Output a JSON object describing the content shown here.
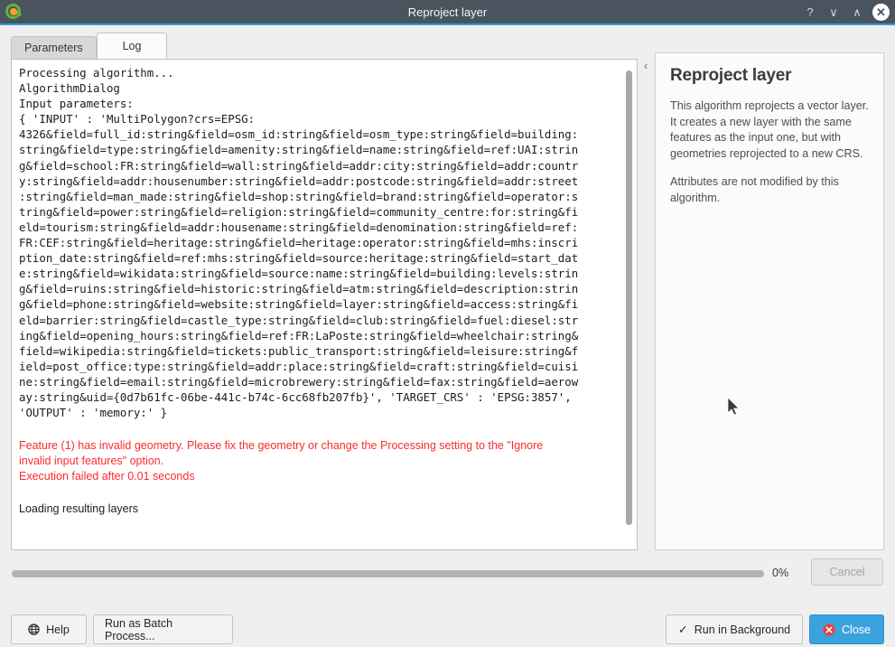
{
  "window": {
    "title": "Reproject layer",
    "logo_icon": "qgis-logo-icon",
    "controls": [
      {
        "name": "help-titlebar-button",
        "icon": "question-mark-icon",
        "glyph": "?"
      },
      {
        "name": "minimize-button",
        "icon": "chevron-down-icon",
        "glyph": "∨"
      },
      {
        "name": "maximize-button",
        "icon": "chevron-up-icon",
        "glyph": "∧"
      },
      {
        "name": "close-window-button",
        "icon": "close-icon",
        "glyph": "✕"
      }
    ]
  },
  "tabs": [
    {
      "label": "Parameters",
      "active": false
    },
    {
      "label": "Log",
      "active": true
    }
  ],
  "log": {
    "monospace_text": "Processing algorithm...\nAlgorithmDialog\nInput parameters:\n{ 'INPUT' : 'MultiPolygon?crs=EPSG:\n4326&field=full_id:string&field=osm_id:string&field=osm_type:string&field=building:\nstring&field=type:string&field=amenity:string&field=name:string&field=ref:UAI:strin\ng&field=school:FR:string&field=wall:string&field=addr:city:string&field=addr:countr\ny:string&field=addr:housenumber:string&field=addr:postcode:string&field=addr:street\n:string&field=man_made:string&field=shop:string&field=brand:string&field=operator:s\ntring&field=power:string&field=religion:string&field=community_centre:for:string&fi\neld=tourism:string&field=addr:housename:string&field=denomination:string&field=ref:\nFR:CEF:string&field=heritage:string&field=heritage:operator:string&field=mhs:inscri\nption_date:string&field=ref:mhs:string&field=source:heritage:string&field=start_dat\ne:string&field=wikidata:string&field=source:name:string&field=building:levels:strin\ng&field=ruins:string&field=historic:string&field=atm:string&field=description:strin\ng&field=phone:string&field=website:string&field=layer:string&field=access:string&fi\neld=barrier:string&field=castle_type:string&field=club:string&field=fuel:diesel:str\ning&field=opening_hours:string&field=ref:FR:LaPoste:string&field=wheelchair:string&\nfield=wikipedia:string&field=tickets:public_transport:string&field=leisure:string&f\nield=post_office:type:string&field=addr:place:string&field=craft:string&field=cuisi\nne:string&field=email:string&field=microbrewery:string&field=fax:string&field=aerow\nay:string&uid={0d7b61fc-06be-441c-b74c-6cc68fb207fb}', 'TARGET_CRS' : 'EPSG:3857',\n'OUTPUT' : 'memory:' }",
    "error_text": "Feature (1) has invalid geometry. Please fix the geometry or change the Processing setting to the \"Ignore\ninvalid input features\" option.\nExecution failed after 0.01 seconds",
    "trailing_text": "Loading resulting layers",
    "error_color": "#fc2b2b"
  },
  "splitter": {
    "collapse_glyph": "‹"
  },
  "help": {
    "title": "Reproject layer",
    "paragraphs": [
      "This algorithm reprojects a vector layer. It creates a new layer with the same features as the input one, but with geometries reprojected to a new CRS.",
      "Attributes are not modified by this algorithm."
    ]
  },
  "progress": {
    "percent_label": "0%",
    "value": 0,
    "cancel_label": "Cancel",
    "track_color": "#b3b3b3"
  },
  "buttons": {
    "help_label": "Help",
    "batch_label": "Run as Batch Process...",
    "background_label": "Run in Background",
    "close_label": "Close",
    "close_accent": "#3aa3dd",
    "check_glyph": "✓"
  }
}
